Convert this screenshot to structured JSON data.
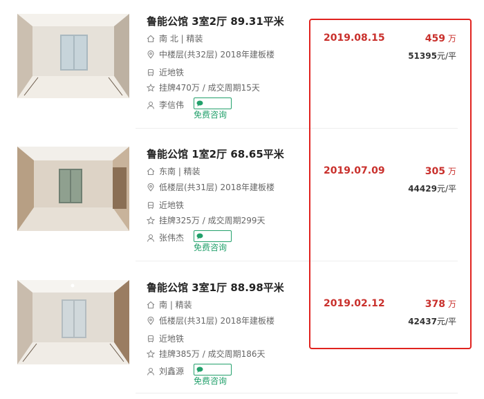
{
  "listings": [
    {
      "title": "鲁能公馆 3室2厅 89.31平米",
      "orientation": "南 北 | 精装",
      "floor": "中楼层(共32层) 2018年建板楼",
      "subway": "近地铁",
      "listing_info": "挂牌470万 / 成交周期15天",
      "agent": "李信伟",
      "consult": "免费咨询",
      "deal_date": "2019.08.15",
      "total_price": "459",
      "total_unit": "万",
      "unit_price": "51395",
      "unit_price_suffix": "元/平"
    },
    {
      "title": "鲁能公馆 1室2厅 68.65平米",
      "orientation": "东南 | 精装",
      "floor": "低楼层(共31层) 2018年建板楼",
      "subway": "近地铁",
      "listing_info": "挂牌325万 / 成交周期299天",
      "agent": "张伟杰",
      "consult": "免费咨询",
      "deal_date": "2019.07.09",
      "total_price": "305",
      "total_unit": "万",
      "unit_price": "44429",
      "unit_price_suffix": "元/平"
    },
    {
      "title": "鲁能公馆 3室1厅 88.98平米",
      "orientation": "南 | 精装",
      "floor": "低楼层(共31层) 2018年建板楼",
      "subway": "近地铁",
      "listing_info": "挂牌385万 / 成交周期186天",
      "agent": "刘鑫源",
      "consult": "免费咨询",
      "deal_date": "2019.02.12",
      "total_price": "378",
      "total_unit": "万",
      "unit_price": "42437",
      "unit_price_suffix": "元/平"
    }
  ],
  "colors": {
    "price_red": "#c9302c",
    "highlight_border": "#e0221e",
    "consult_green": "#22a06b"
  },
  "icons": [
    "house-icon",
    "location-icon",
    "subway-icon",
    "star-icon",
    "person-icon",
    "chat-bubble-icon"
  ]
}
